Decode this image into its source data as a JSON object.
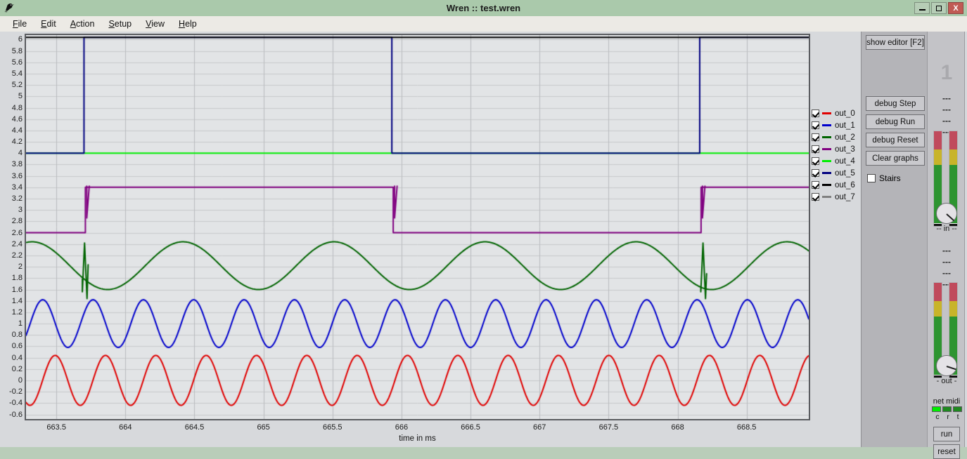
{
  "window": {
    "title": "Wren :: test.wren",
    "icon": "wren-bird-icon",
    "minimize_label": "minimize",
    "maximize_label": "maximize",
    "close_label": "X"
  },
  "menubar": {
    "items": [
      {
        "label": "File",
        "mnemonic": "F"
      },
      {
        "label": "Edit",
        "mnemonic": "E"
      },
      {
        "label": "Action",
        "mnemonic": "A"
      },
      {
        "label": "Setup",
        "mnemonic": "S"
      },
      {
        "label": "View",
        "mnemonic": "V"
      },
      {
        "label": "Help",
        "mnemonic": "H"
      }
    ]
  },
  "controls": {
    "show_editor": "show editor [F2]",
    "debug_step": "debug Step",
    "debug_run": "debug Run",
    "debug_reset": "debug Reset",
    "clear_graphs": "Clear graphs",
    "stairs": "Stairs",
    "stairs_checked": false
  },
  "mixer": {
    "channel_number": "1",
    "dash_rows": [
      "---",
      "---",
      "---",
      "---"
    ],
    "in_label": "-- in --",
    "out_label": "- out -",
    "net_midi_label": "net midi",
    "led_letters": [
      "c",
      "r",
      "t"
    ],
    "led_colors": [
      "#00ee00",
      "#1f8a1f",
      "#1f8a1f"
    ],
    "run_label": "run",
    "reset_label": "reset"
  },
  "legend": {
    "entries": [
      {
        "label": "out_0",
        "color": "#e00000",
        "checked": true
      },
      {
        "label": "out_1",
        "color": "#0000cc",
        "checked": true
      },
      {
        "label": "out_2",
        "color": "#006400",
        "checked": true
      },
      {
        "label": "out_3",
        "color": "#800080",
        "checked": true
      },
      {
        "label": "out_4",
        "color": "#00ee00",
        "checked": true
      },
      {
        "label": "out_5",
        "color": "#000080",
        "checked": true
      },
      {
        "label": "out_6",
        "color": "#000000",
        "checked": true
      },
      {
        "label": "out_7",
        "color": "#808080",
        "checked": true
      }
    ]
  },
  "chart_data": {
    "type": "line",
    "title": "",
    "xlabel": "time in ms",
    "ylabel": "",
    "xlim": [
      663.28,
      668.95
    ],
    "ylim": [
      -0.68,
      6.08
    ],
    "grid": true,
    "legend_position": "right",
    "xticks": [
      663.5,
      664,
      664.5,
      665,
      665.5,
      666,
      666.5,
      667,
      667.5,
      668,
      668.5
    ],
    "xtick_labels": [
      "663.5",
      "664",
      "664.5",
      "665",
      "665.5",
      "666",
      "666.5",
      "667",
      "667.5",
      "668",
      "668.5"
    ],
    "yticks": [
      -0.6,
      -0.4,
      -0.2,
      0,
      0.2,
      0.4,
      0.6,
      0.8,
      1,
      1.2,
      1.4,
      1.6,
      1.8,
      2,
      2.2,
      2.4,
      2.6,
      2.8,
      3,
      3.2,
      3.4,
      3.6,
      3.8,
      4,
      4.2,
      4.4,
      4.6,
      4.8,
      5,
      5.2,
      5.4,
      5.6,
      5.8,
      6
    ],
    "ytick_labels": [
      "-0.6",
      "-0.4",
      "-0.2",
      "0",
      "0.2",
      "0.4",
      "0.6",
      "0.8",
      "1",
      "1.2",
      "1.4",
      "1.6",
      "1.8",
      "2",
      "2.2",
      "2.4",
      "2.6",
      "2.8",
      "3",
      "3.2",
      "3.4",
      "3.6",
      "3.8",
      "4",
      "4.2",
      "4.4",
      "4.6",
      "4.8",
      "5",
      "5.2",
      "5.4",
      "5.6",
      "5.8",
      "6"
    ],
    "series": [
      {
        "name": "out_0",
        "color": "#e00000",
        "kind": "sine",
        "offset": 0.0,
        "amplitude": 0.44,
        "period_ms": 0.3646,
        "phase_ms": 663.4
      },
      {
        "name": "out_1",
        "color": "#0000cc",
        "kind": "sine",
        "offset": 1.0,
        "amplitude": 0.42,
        "period_ms": 0.3646,
        "phase_ms": 663.31
      },
      {
        "name": "out_2",
        "color": "#006400",
        "kind": "sine-glitch",
        "offset": 2.02,
        "amplitude": 0.42,
        "period_ms": 1.0938,
        "phase_ms": 663.05,
        "glitch_times": [
          663.7,
          668.18
        ],
        "glitch_low": 1.56,
        "glitch_high": 2.42
      },
      {
        "name": "out_3",
        "color": "#800080",
        "kind": "square",
        "low": 2.6,
        "high": 3.4,
        "edges": [
          663.71,
          665.94,
          668.17
        ],
        "glitch_low": 2.86,
        "glitch_high": 3.42
      },
      {
        "name": "out_4",
        "color": "#00ee00",
        "kind": "constant",
        "value": 4.0
      },
      {
        "name": "out_5",
        "color": "#000080",
        "kind": "square",
        "low": 4.0,
        "high": 6.04,
        "edges": [
          663.7,
          665.93,
          668.16
        ]
      },
      {
        "name": "out_6",
        "color": "#000000",
        "kind": "constant",
        "value": 6.04
      },
      {
        "name": "out_7",
        "color": "#808080",
        "kind": "hidden",
        "value": null
      }
    ]
  }
}
